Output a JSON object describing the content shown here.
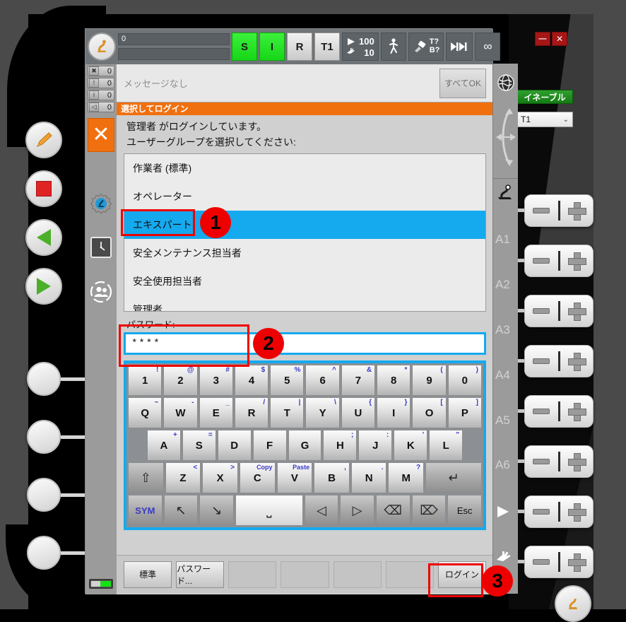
{
  "window": {
    "minimize_label": "—",
    "close_label": "✕"
  },
  "toolbar": {
    "robot_icon": "robot-icon",
    "bar_top_value": "0",
    "bar_bottom_value": "",
    "buttons": [
      {
        "label": "S",
        "name": "status-s-button",
        "style": "green"
      },
      {
        "label": "I",
        "name": "status-i-button",
        "style": "green"
      },
      {
        "label": "R",
        "name": "status-r-button",
        "style": "light"
      },
      {
        "label": "T1",
        "name": "mode-t1-button",
        "style": "light"
      }
    ],
    "speed_program": "100",
    "speed_jog": "10",
    "walk_icon": "walking-man-icon",
    "tool_icon": "tool-icon",
    "tool_t_label": "T?",
    "tool_b_label": "B?",
    "step_icon": "step-mode-icon",
    "infinity_label": "∞"
  },
  "message_bar": {
    "text": "メッセージなし",
    "ack_all_label": "すべてOK"
  },
  "status_counters": [
    {
      "icon": "error-icon",
      "count": "0"
    },
    {
      "icon": "warning-icon",
      "count": "0"
    },
    {
      "icon": "info-icon",
      "count": "0"
    },
    {
      "icon": "wait-icon",
      "count": "0"
    }
  ],
  "side_icons": [
    {
      "name": "close-x-tile",
      "label": "✕"
    },
    {
      "name": "gear-robot-icon",
      "label": ""
    },
    {
      "name": "clock-icon",
      "label": ""
    },
    {
      "name": "user-group-icon",
      "label": ""
    }
  ],
  "dialog": {
    "title": "選択してログイン",
    "line1": "管理者 がログインしています。",
    "line2": "ユーザーグループを選択してください:",
    "groups": [
      {
        "label": "作業者 (標準)",
        "selected": false
      },
      {
        "label": "オペレーター",
        "selected": false
      },
      {
        "label": "エキスパート",
        "selected": true
      },
      {
        "label": "安全メンテナンス担当者",
        "selected": false
      },
      {
        "label": "安全使用担当者",
        "selected": false
      },
      {
        "label": "管理者",
        "selected": false
      }
    ],
    "password_label": "パスワード:",
    "password_value": "****"
  },
  "keyboard": {
    "rows": [
      [
        {
          "main": "1",
          "alt": "!"
        },
        {
          "main": "2",
          "alt": "@"
        },
        {
          "main": "3",
          "alt": "#"
        },
        {
          "main": "4",
          "alt": "$"
        },
        {
          "main": "5",
          "alt": "%"
        },
        {
          "main": "6",
          "alt": "^"
        },
        {
          "main": "7",
          "alt": "&"
        },
        {
          "main": "8",
          "alt": "*"
        },
        {
          "main": "9",
          "alt": "("
        },
        {
          "main": "0",
          "alt": ")"
        }
      ],
      [
        {
          "main": "Q",
          "alt": "~"
        },
        {
          "main": "W",
          "alt": "-"
        },
        {
          "main": "E",
          "alt": "_"
        },
        {
          "main": "R",
          "alt": "/"
        },
        {
          "main": "T",
          "alt": "|"
        },
        {
          "main": "Y",
          "alt": "\\"
        },
        {
          "main": "U",
          "alt": "{"
        },
        {
          "main": "I",
          "alt": "}"
        },
        {
          "main": "O",
          "alt": "["
        },
        {
          "main": "P",
          "alt": "]"
        }
      ],
      [
        {
          "main": "A",
          "alt": "+"
        },
        {
          "main": "S",
          "alt": "="
        },
        {
          "main": "D",
          "alt": ""
        },
        {
          "main": "F",
          "alt": ""
        },
        {
          "main": "G",
          "alt": ""
        },
        {
          "main": "H",
          "alt": ";"
        },
        {
          "main": "J",
          "alt": ":"
        },
        {
          "main": "K",
          "alt": "'"
        },
        {
          "main": "L",
          "alt": "\""
        }
      ],
      [
        {
          "main": "⇧",
          "alt": "",
          "kind": "dark",
          "name": "shift-key"
        },
        {
          "main": "Z",
          "alt": "<"
        },
        {
          "main": "X",
          "alt": ">"
        },
        {
          "main": "C",
          "alt": "Copy"
        },
        {
          "main": "V",
          "alt": "Paste"
        },
        {
          "main": "B",
          "alt": ","
        },
        {
          "main": "N",
          "alt": "."
        },
        {
          "main": "M",
          "alt": "?"
        },
        {
          "main": "↵",
          "alt": "",
          "kind": "dark",
          "name": "enter-key"
        }
      ],
      [
        {
          "main": "SYM",
          "alt": "",
          "kind": "dark",
          "name": "symbol-key"
        },
        {
          "main": "↖",
          "alt": "",
          "kind": "dark",
          "name": "home-key"
        },
        {
          "main": "↘",
          "alt": "",
          "kind": "dark",
          "name": "end-key"
        },
        {
          "main": "⎵",
          "alt": "",
          "kind": "space",
          "name": "space-key"
        },
        {
          "main": "◁",
          "alt": "",
          "kind": "dark",
          "name": "arrow-left-key"
        },
        {
          "main": "▷",
          "alt": "",
          "kind": "dark",
          "name": "arrow-right-key"
        },
        {
          "main": "⌫",
          "alt": "",
          "kind": "dark",
          "name": "backspace-key"
        },
        {
          "main": "⌦",
          "alt": "",
          "kind": "dark",
          "name": "delete-key"
        },
        {
          "main": "Esc",
          "alt": "",
          "kind": "dark",
          "name": "escape-key"
        }
      ]
    ]
  },
  "function_bar": [
    {
      "label": "標準",
      "empty": false,
      "name": "fn-default-button"
    },
    {
      "label": "パスワード...",
      "empty": false,
      "name": "fn-password-button"
    },
    {
      "label": "",
      "empty": true,
      "name": "fn-empty-3"
    },
    {
      "label": "",
      "empty": true,
      "name": "fn-empty-4"
    },
    {
      "label": "",
      "empty": true,
      "name": "fn-empty-5"
    },
    {
      "label": "",
      "empty": true,
      "name": "fn-empty-6"
    },
    {
      "label": "ログイン",
      "empty": false,
      "name": "fn-login-button"
    }
  ],
  "right_strip": {
    "globe_icon": "globe-icon",
    "arrows_icon": "coordinate-arrows-icon",
    "robot_tool_icon": "robot-tool-icon",
    "axis_labels": [
      "A1",
      "A2",
      "A3",
      "A4",
      "A5",
      "A6"
    ],
    "play_icon": "play-triangle-icon",
    "hand_icon": "hand-icon"
  },
  "right_panel": {
    "enable_label": "イネーブル",
    "mode_value": "T1",
    "mode_chevron": "⌄",
    "jog_minus": "−",
    "jog_plus": "+",
    "jog_count": 8
  },
  "callouts": [
    {
      "number": "1",
      "target": "group-item-expert"
    },
    {
      "number": "2",
      "target": "password-field"
    },
    {
      "number": "3",
      "target": "login-button"
    }
  ],
  "colors": {
    "accent_orange": "#f07010",
    "selection_blue": "#15a9ee",
    "callout_red": "#ef0000",
    "enable_green": "#2fa02f",
    "status_green": "#17d617"
  }
}
